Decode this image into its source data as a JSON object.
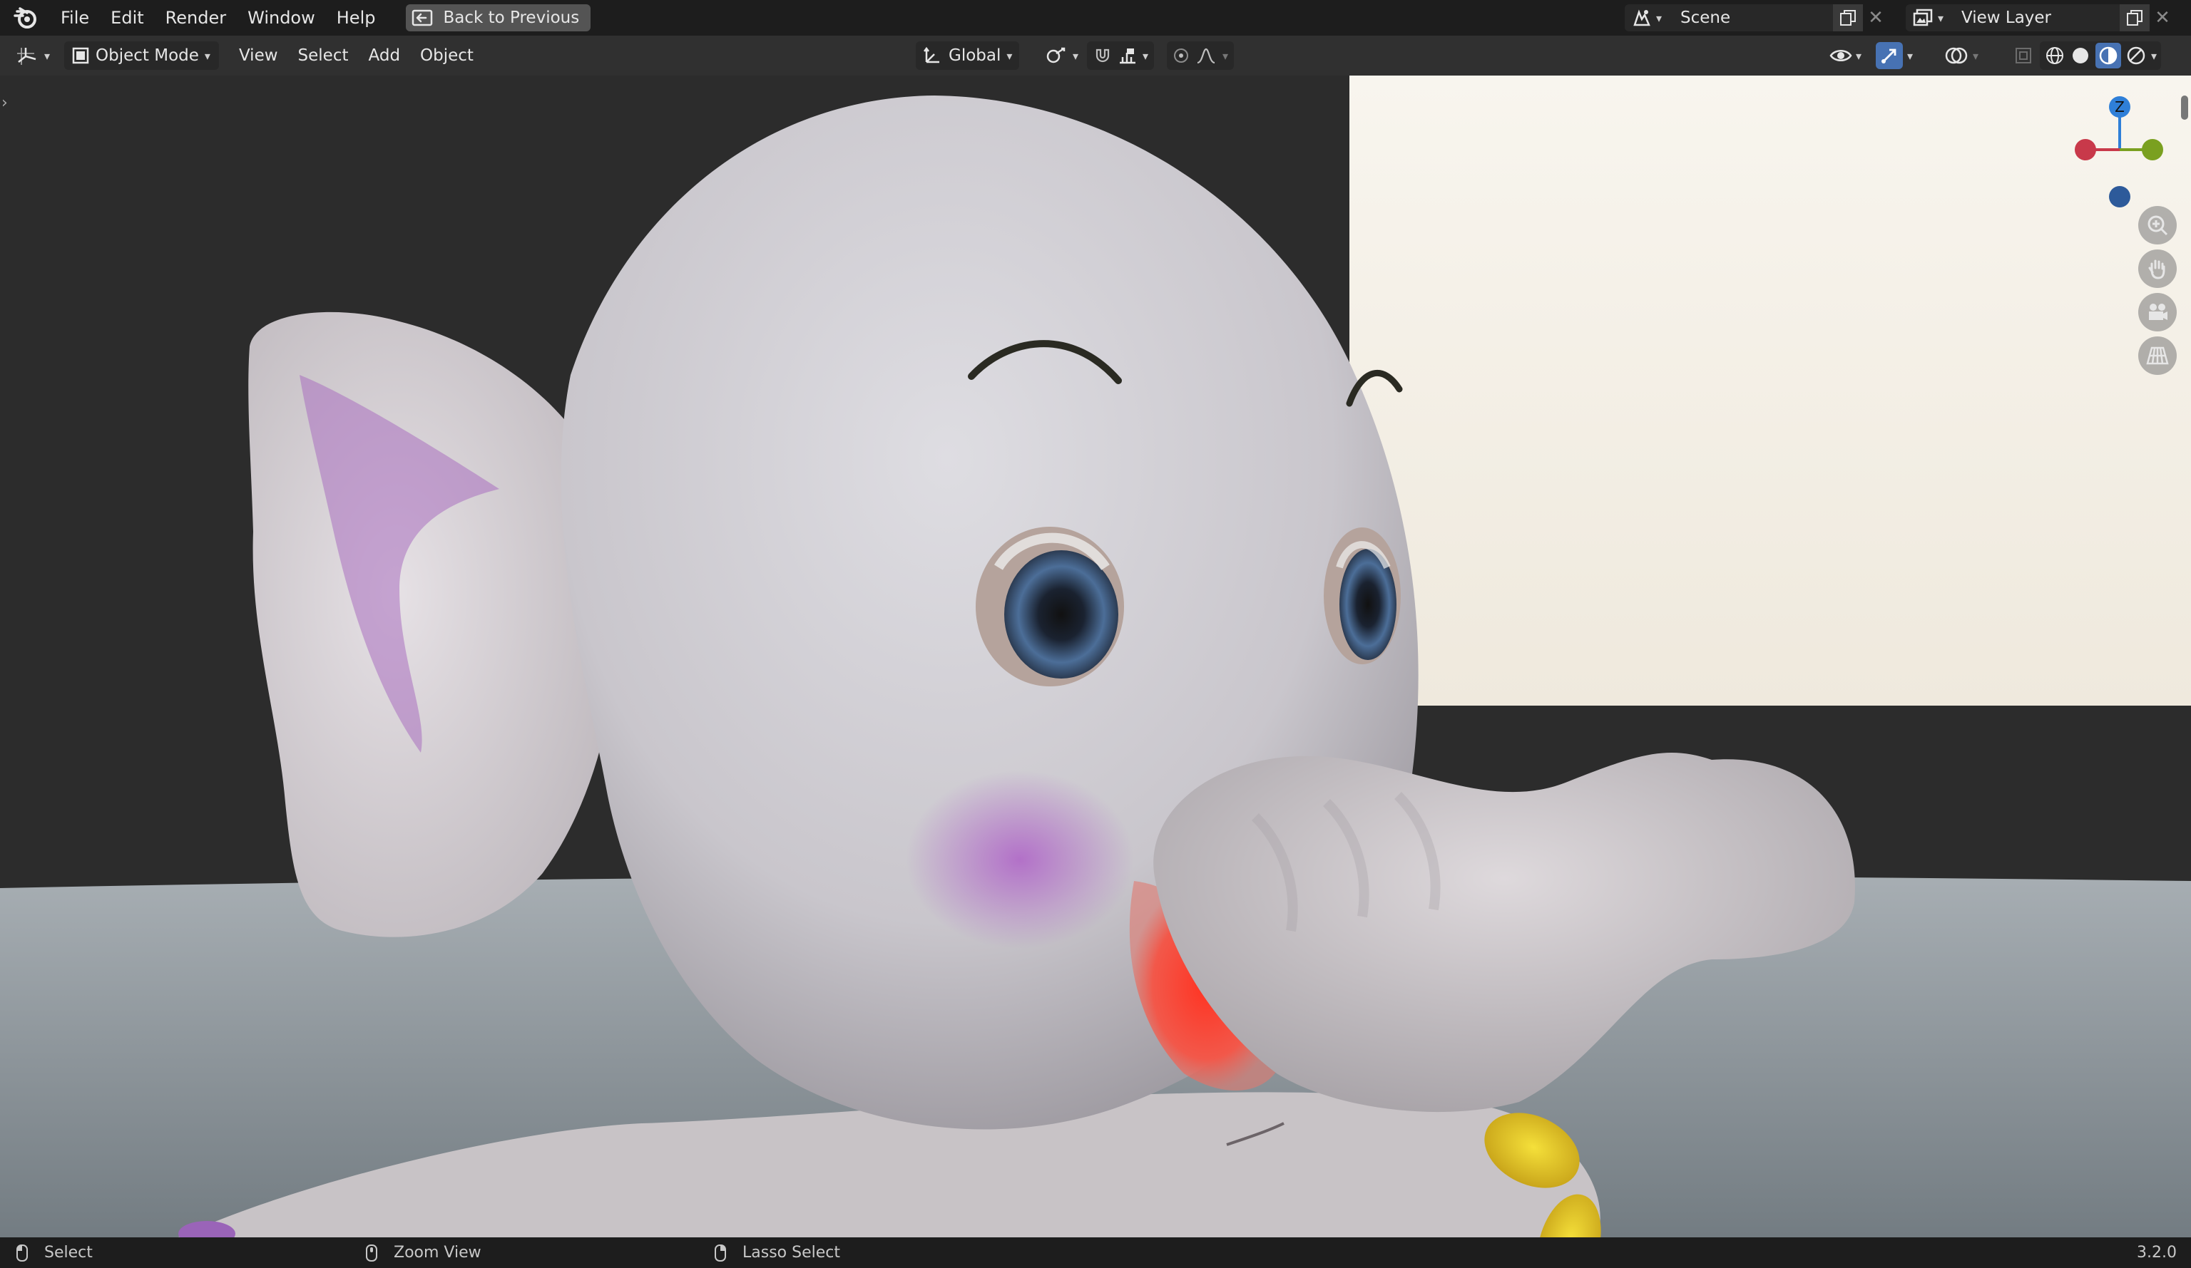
{
  "topbar": {
    "menus": [
      "File",
      "Edit",
      "Render",
      "Window",
      "Help"
    ],
    "back_button_label": "Back to Previous",
    "scene_name": "Scene",
    "view_layer_name": "View Layer"
  },
  "viewport_header": {
    "mode_label": "Object Mode",
    "menus": [
      "View",
      "Select",
      "Add",
      "Object"
    ],
    "transform_orientation": "Global"
  },
  "gizmo": {
    "z_label": "Z",
    "colors": {
      "x": "#c8394a",
      "y": "#7aa020",
      "z": "#2f7fd8",
      "neg_z": "#2d5a9a"
    }
  },
  "nav_icons": [
    "zoom-icon",
    "hand-icon",
    "camera-icon",
    "grid-icon"
  ],
  "statusbar": {
    "items": [
      "Select",
      "Zoom View",
      "Lasso Select"
    ],
    "version": "3.2.0"
  },
  "accent_color": "#4772b3"
}
